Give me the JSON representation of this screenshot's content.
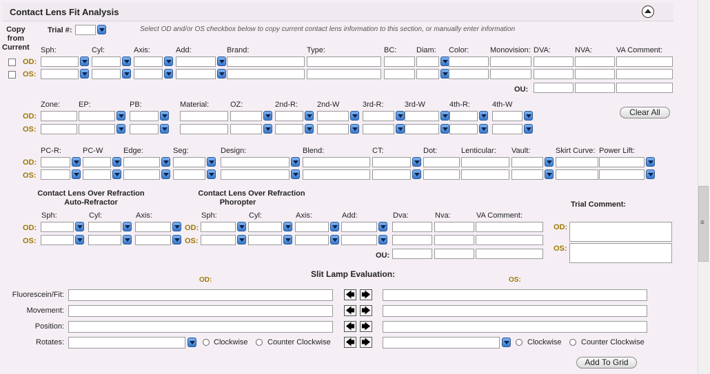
{
  "panel": {
    "title": "Contact Lens Fit Analysis",
    "copy_from_current": "Copy\nfrom\nCurrent",
    "trial_label": "Trial #:",
    "instructions": "Select OD and/or OS checkbox below to copy current contact lens information to this section, or manually enter information"
  },
  "eyes": {
    "od": "OD:",
    "os": "OS:",
    "ou": "OU:"
  },
  "lens_row1": [
    "Sph:",
    "Cyl:",
    "Axis:",
    "Add:",
    "Brand:",
    "Type:",
    "BC:",
    "Diam:",
    "Color:",
    "Monovision:",
    "DVA:",
    "NVA:",
    "VA Comment:"
  ],
  "lens_row2": [
    "Zone:",
    "EP:",
    "PB:",
    "Material:",
    "OZ:",
    "2nd-R:",
    "2nd-W",
    "3rd-R:",
    "3rd-W",
    "4th-R:",
    "4th-W"
  ],
  "lens_row3": [
    "PC-R:",
    "PC-W",
    "Edge:",
    "Seg:",
    "Design:",
    "Blend:",
    "CT:",
    "Dot:",
    "Lenticular:",
    "Vault:",
    "Skirt Curve:",
    "Power Lift:"
  ],
  "buttons": {
    "clear_all": "Clear All",
    "add_to_grid": "Add To Grid"
  },
  "over_refraction": {
    "auto_title_1": "Contact Lens Over Refraction",
    "auto_title_2": "Auto-Refractor",
    "phor_title_1": "Contact Lens Over Refraction",
    "phor_title_2": "Phoropter",
    "auto_fields": [
      "Sph:",
      "Cyl:",
      "Axis:"
    ],
    "phor_fields": [
      "Sph:",
      "Cyl:",
      "Axis:",
      "Add:",
      "Dva:",
      "Nva:",
      "VA Comment:"
    ],
    "trial_comment": "Trial Comment:"
  },
  "slit_lamp": {
    "title": "Slit Lamp Evaluation:",
    "od": "OD:",
    "os": "OS:",
    "rows": [
      "Fluorescein/Fit:",
      "Movement:",
      "Position:",
      "Rotates:"
    ],
    "clockwise": "Clockwise",
    "counter_clockwise": "Counter Clockwise"
  },
  "colors": {
    "panel_bg": "#f5eff5",
    "eye_label": "#a07800",
    "dropdown": "#3a78c9"
  },
  "icons": {
    "collapse": "chevron-up-circle-icon",
    "arrow_left": "arrow-left-icon",
    "arrow_right": "arrow-right-icon",
    "dropdown": "chevron-down-icon"
  }
}
